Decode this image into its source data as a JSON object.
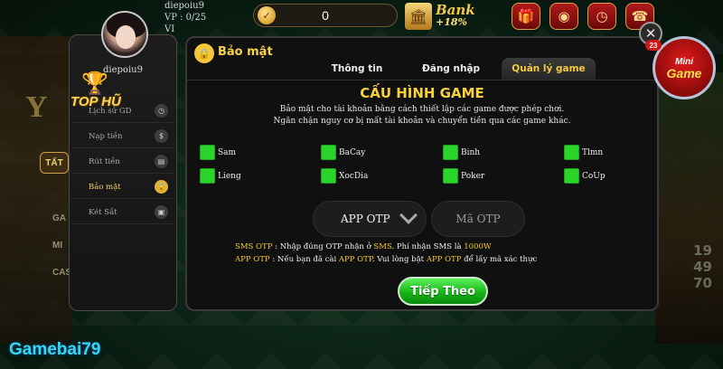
{
  "topbar": {
    "username": "diepoiu9",
    "vp": "VP : 0/25",
    "vip": "VI",
    "coins": "0",
    "bank_label": "Bank",
    "bank_rate": "+18%"
  },
  "sidebar": {
    "username": "diepoiu9",
    "tophu": "TOP HŨ",
    "items": [
      {
        "label": "Lịch sử GD",
        "icon": "history-icon"
      },
      {
        "label": "Nạp tiền",
        "icon": "deposit-icon"
      },
      {
        "label": "Rút tiền",
        "icon": "withdraw-icon"
      },
      {
        "label": "Bảo mật",
        "icon": "lock-icon",
        "active": true
      },
      {
        "label": "Két Sắt",
        "icon": "safe-icon"
      }
    ]
  },
  "background": {
    "tat": "TẤT",
    "left_labels": [
      "GA",
      "MI",
      "CAS"
    ],
    "right_numbers": [
      "19",
      "49",
      "70"
    ]
  },
  "panel": {
    "title": "Bảo mật",
    "tabs": [
      "Thông tin",
      "Đăng nhập",
      "Quản lý game"
    ],
    "active_tab": "Quản lý game",
    "config_title": "CẤU HÌNH GAME",
    "desc_line1": "Bảo mật cho tài khoản bằng cách thiết lập các game được phép chơi.",
    "desc_line2": "Ngăn chặn nguy cơ bị mất tài khoản và chuyển tiền qua các game khác.",
    "games": [
      "Sam",
      "BaCay",
      "Binh",
      "Tlmn",
      "Lieng",
      "XocDia",
      "Poker",
      "CoUp"
    ],
    "otp_method": "APP OTP",
    "otp_placeholder": "Mã OTP",
    "note_sms_prefix": "SMS OTP",
    "note_sms_text": " : Nhập đúng OTP nhận ở ",
    "note_sms_hl": "SMS",
    "note_sms_text2": ". Phí nhận SMS là ",
    "note_sms_fee": "1000W",
    "note_app_prefix": "APP OTP",
    "note_app_text": " : Nếu bạn đã cài ",
    "note_app_hl": "APP OTP",
    "note_app_text2": ". Vui lòng bật ",
    "note_app_hl2": "APP OTP",
    "note_app_text3": " để lấy mã xác thực",
    "continue_label": "Tiếp Theo"
  },
  "mini_game": {
    "top": "Mini",
    "bottom": "Game",
    "badge": "23"
  },
  "watermark": "Gamebai79",
  "colors": {
    "accent_gold": "#f7d24a",
    "checkbox_green": "#2bd42b",
    "button_green": "#16b516"
  }
}
